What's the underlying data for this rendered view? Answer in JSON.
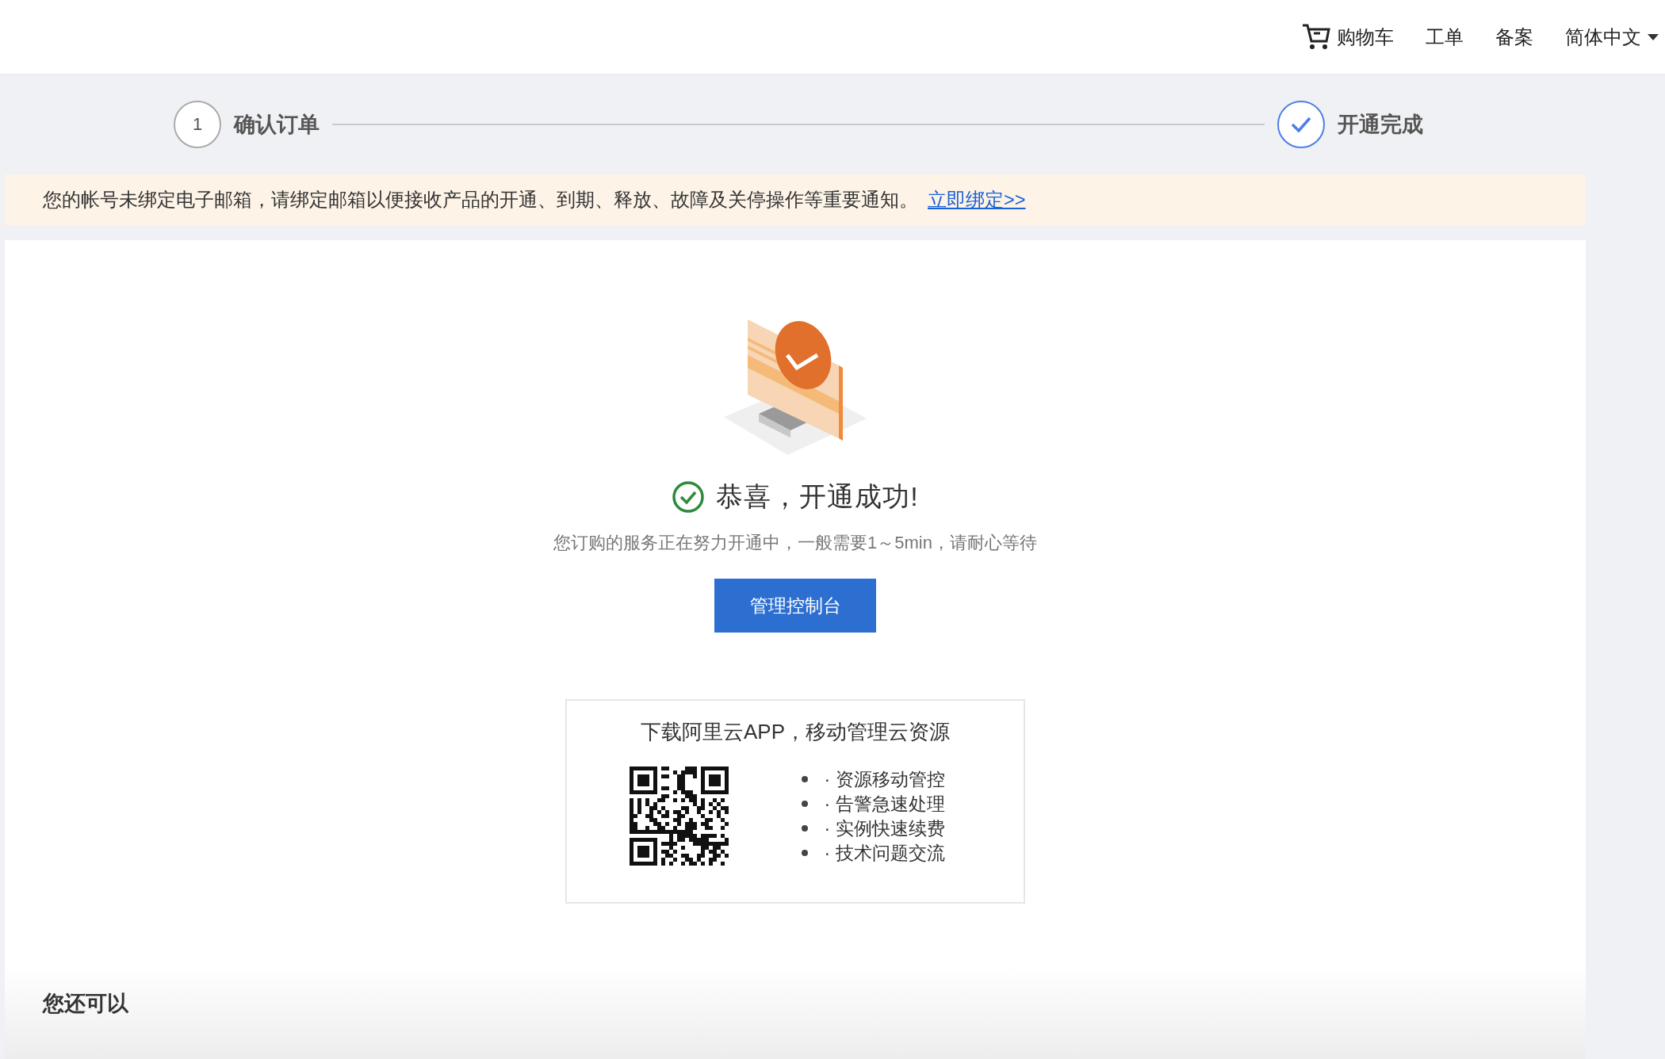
{
  "header": {
    "nav": [
      {
        "label": "购物车",
        "kind": "cart"
      },
      {
        "label": "工单",
        "kind": "link"
      },
      {
        "label": "备案",
        "kind": "link"
      },
      {
        "label": "简体中文",
        "kind": "dropdown"
      }
    ]
  },
  "steps": [
    {
      "number": "1",
      "label": "确认订单",
      "kind": "number",
      "selected": false
    },
    {
      "label": "开通完成",
      "kind": "check",
      "selected": true
    }
  ],
  "notice": {
    "text": "您的帐号未绑定电子邮箱，请绑定邮箱以便接收产品的开通、到期、释放、故障及关停操作等重要通知。",
    "link": "立即绑定>>"
  },
  "result": {
    "title": "恭喜，开通成功!",
    "subtitle": "您订购的服务正在努力开通中，一般需要1～5min，请耐心等待",
    "button": "管理控制台"
  },
  "app_promo": {
    "title": "下载阿里云APP，移动管理云资源",
    "features": [
      "· 资源移动管控",
      "· 告警急速处理",
      "· 实例快速续费",
      "· 技术问题交流"
    ]
  },
  "more": {
    "title": "您还可以"
  }
}
